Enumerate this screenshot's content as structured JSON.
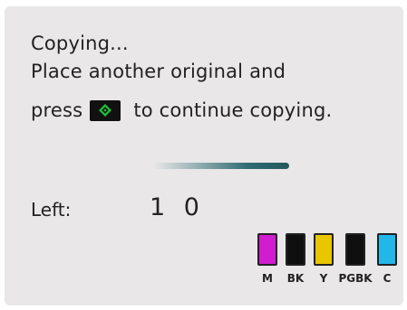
{
  "message": {
    "line1": "Copying...",
    "line2": "Place another original and",
    "line3_before": "press",
    "line3_after": "to continue copying."
  },
  "start_key_icon": "start-diamond-icon",
  "progress": {
    "state": "indeterminate"
  },
  "remaining": {
    "label": "Left:",
    "value": "1 0"
  },
  "ink": [
    {
      "name": "M",
      "color": "#d21ccf"
    },
    {
      "name": "BK",
      "color": "#0f0f0f"
    },
    {
      "name": "Y",
      "color": "#e8c600"
    },
    {
      "name": "PGBK",
      "color": "#0f0f0f"
    },
    {
      "name": "C",
      "color": "#23b7e8"
    }
  ],
  "colors": {
    "background": "#e9e7e8",
    "text": "#222222",
    "start_key": "#111111",
    "start_diamond": "#1fbf3a"
  }
}
